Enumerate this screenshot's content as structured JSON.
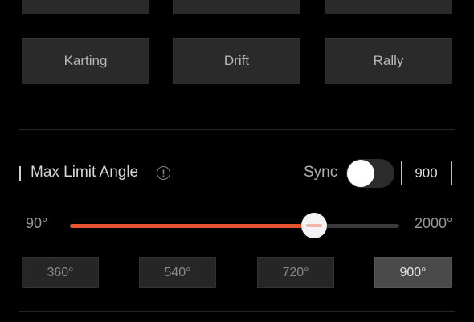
{
  "modes_top": [
    {
      "label": ""
    },
    {
      "label": ""
    },
    {
      "label": ""
    }
  ],
  "modes": [
    {
      "label": "Karting"
    },
    {
      "label": "Drift"
    },
    {
      "label": "Rally"
    }
  ],
  "max_limit": {
    "title": "Max Limit Angle",
    "info_icon": "info-circle-icon",
    "sync_label": "Sync",
    "sync_on": false,
    "value": "900",
    "min_label": "90°",
    "max_label": "2000°",
    "min": 90,
    "max": 2000,
    "current": 900
  },
  "presets": [
    {
      "label": "360°",
      "selected": false
    },
    {
      "label": "540°",
      "selected": false
    },
    {
      "label": "720°",
      "selected": false
    },
    {
      "label": "900°",
      "selected": true
    }
  ],
  "colors": {
    "accent": "#e8542e",
    "background": "#000000",
    "button": "#2a2a2a",
    "selected": "#4a4a4a"
  }
}
